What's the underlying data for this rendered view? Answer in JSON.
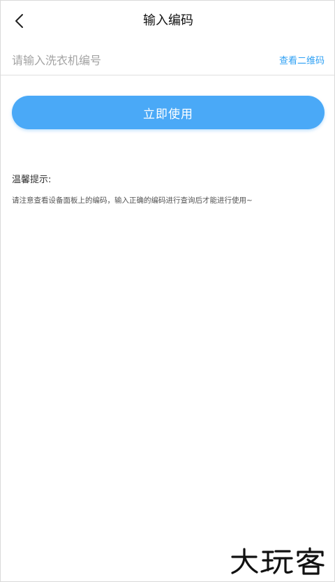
{
  "header": {
    "title": "输入编码",
    "back_icon": "chevron-left-icon"
  },
  "input": {
    "placeholder": "请输入洗衣机编号",
    "value": "",
    "qr_link_label": "查看二维码"
  },
  "action": {
    "use_button_label": "立即使用",
    "button_color": "#4aa9f7"
  },
  "tips": {
    "title": "温馨提示:",
    "text": "请注意查看设备面板上的编码，输入正确的编码进行查询后才能进行使用~"
  },
  "watermark": {
    "text": "大玩客"
  },
  "colors": {
    "link": "#2ea0f4",
    "accent": "#4aa9f7"
  }
}
